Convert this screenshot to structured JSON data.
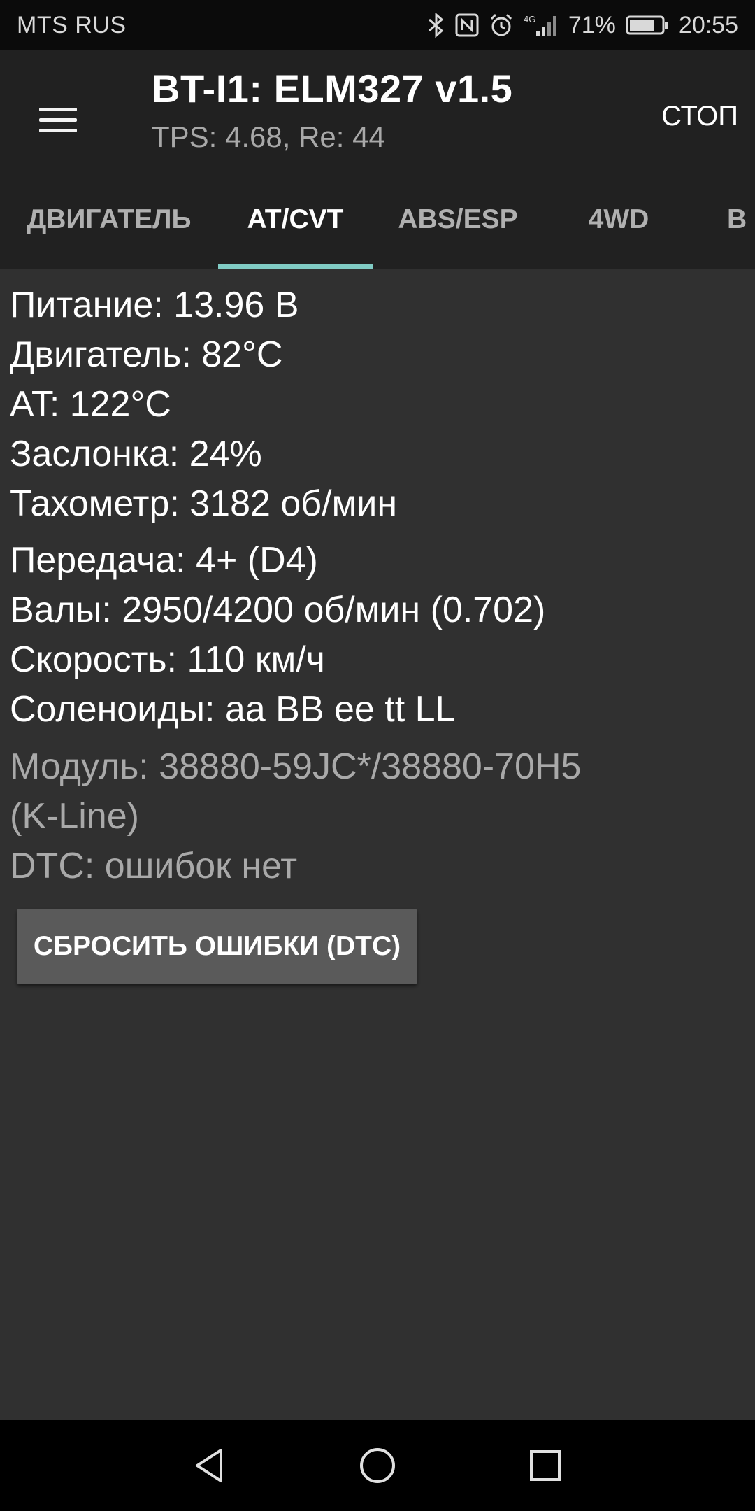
{
  "status_bar": {
    "carrier": "MTS RUS",
    "signal_label": "4G",
    "battery": "71%",
    "time": "20:55"
  },
  "app_bar": {
    "title": "BT-I1: ELM327 v1.5",
    "subtitle": "TPS: 4.68, Re: 44",
    "stop_label": "СТОП"
  },
  "tabs": [
    {
      "label": "ДВИГАТЕЛЬ",
      "active": false
    },
    {
      "label": "AT/CVT",
      "active": true
    },
    {
      "label": "ABS/ESP",
      "active": false
    },
    {
      "label": "4WD",
      "active": false
    },
    {
      "label": "B",
      "active": false
    }
  ],
  "readings": [
    "Питание: 13.96 В",
    "Двигатель: 82°C",
    "AT: 122°C",
    "Заслонка: 24%",
    "Тахометр: 3182 об/мин",
    "Передача: 4+ (D4)",
    "Валы: 2950/4200 об/мин (0.702)",
    "Скорость: 110 км/ч",
    "Соленоиды: aa BB ee tt LL"
  ],
  "module_info": {
    "module_line1": "Модуль: 38880-59JC*/38880-70H5",
    "module_line2": "(K-Line)",
    "dtc": "DTC: ошибок нет"
  },
  "reset_button_label": "СБРОСИТЬ ОШИБКИ (DTC)",
  "colors": {
    "tab_indicator": "#80cbc4",
    "app_bar": "#212121",
    "background": "#303030"
  }
}
